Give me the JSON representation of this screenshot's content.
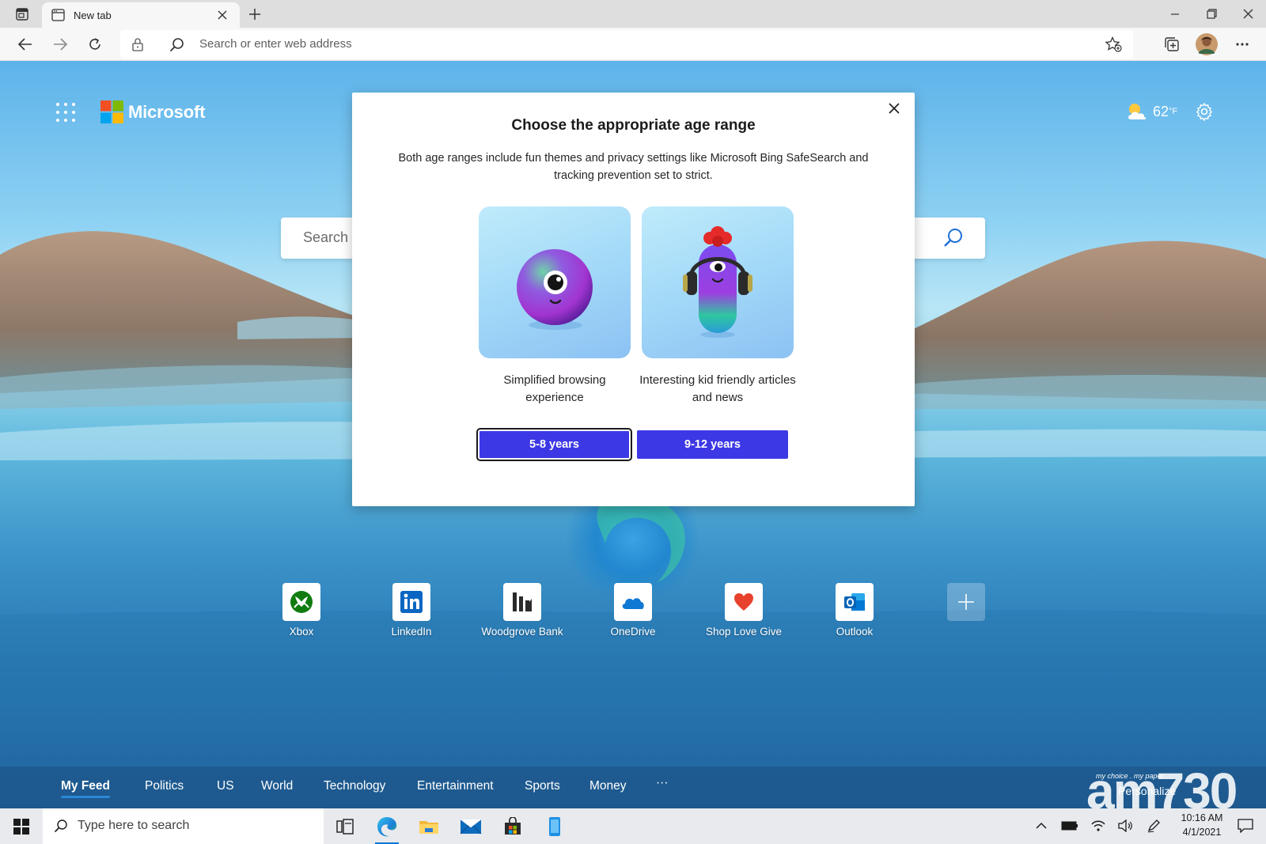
{
  "browser": {
    "tab_title": "New tab",
    "address_placeholder": "Search or enter web address"
  },
  "page": {
    "brand_name": "Microsoft",
    "weather_temp": "62",
    "weather_unit": "°F",
    "search_placeholder": "Search",
    "quick_links": [
      {
        "label": "Xbox",
        "icon": "xbox-icon"
      },
      {
        "label": "LinkedIn",
        "icon": "linkedin-icon"
      },
      {
        "label": "Woodgrove Bank",
        "icon": "woodgrove-bank-icon"
      },
      {
        "label": "OneDrive",
        "icon": "onedrive-icon"
      },
      {
        "label": "Shop Love Give",
        "icon": "heart-icon"
      },
      {
        "label": "Outlook",
        "icon": "outlook-icon"
      }
    ],
    "feed_tabs": [
      "My Feed",
      "Politics",
      "US",
      "World",
      "Technology",
      "Entertainment",
      "Sports",
      "Money"
    ],
    "feed_more": "···",
    "personalize_label": "Personalize",
    "watermark_tagline": "my choice . my paper",
    "watermark_brand": "am730"
  },
  "modal": {
    "title": "Choose the appropriate age range",
    "description": "Both age ranges include fun themes and privacy settings like Microsoft Bing SafeSearch and tracking prevention set to strict.",
    "options": [
      {
        "caption": "Simplified browsing experience",
        "button": "5-8 years",
        "icon": "one-eyed-ball-character-icon"
      },
      {
        "caption": "Interesting kid friendly articles and news",
        "button": "9-12 years",
        "icon": "headphone-character-icon"
      }
    ]
  },
  "taskbar": {
    "search_placeholder": "Type here to search",
    "time": "10:16 AM",
    "date": "4/1/2021"
  },
  "colors": {
    "accent_button": "#3d38e5",
    "active_underline": "#2b88d8"
  }
}
